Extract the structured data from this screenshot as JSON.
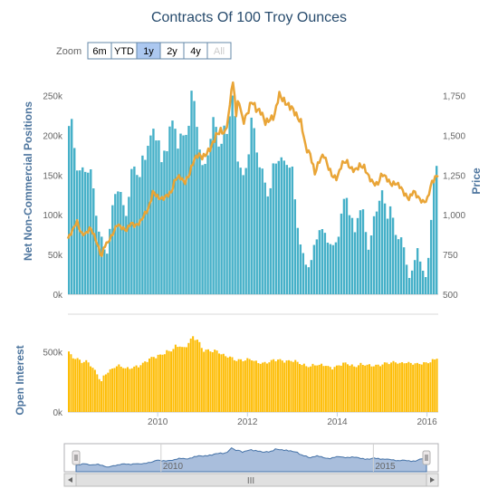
{
  "chart_data": {
    "title": "Contracts Of 100 Troy Ounces",
    "zoom": {
      "label": "Zoom",
      "buttons": [
        {
          "label": "6m",
          "state": "normal"
        },
        {
          "label": "YTD",
          "state": "normal"
        },
        {
          "label": "1y",
          "state": "selected"
        },
        {
          "label": "2y",
          "state": "normal"
        },
        {
          "label": "4y",
          "state": "normal"
        },
        {
          "label": "All",
          "state": "disabled"
        }
      ]
    },
    "colors": {
      "positions": "#45b0c8",
      "price": "#e9a537",
      "open_interest": "#fdbd06",
      "navigator_fill": "#a9bedc",
      "navigator_line": "#4572a7",
      "axis_title": "#4d759e",
      "title": "#274b6d"
    },
    "x_axis": {
      "type": "datetime",
      "range": [
        2008.0,
        2016.25
      ],
      "ticks": [
        "2010",
        "2012",
        "2014",
        "2016"
      ],
      "tick_values": [
        2010,
        2012,
        2014,
        2016
      ]
    },
    "top_panel": {
      "type": "column+line",
      "left_axis": {
        "title": "Net Non-Commercial Positions",
        "range": [
          0,
          270000
        ],
        "ticks": [
          "0k",
          "50k",
          "100k",
          "150k",
          "200k",
          "250k"
        ],
        "tick_values": [
          0,
          50000,
          100000,
          150000,
          200000,
          250000
        ]
      },
      "right_axis": {
        "title": "Price",
        "range": [
          500,
          1850
        ],
        "ticks": [
          "500",
          "750",
          "1,000",
          "1,250",
          "1,500",
          "1,750"
        ],
        "tick_values": [
          500,
          750,
          1000,
          1250,
          1500,
          1750
        ]
      },
      "positions": [
        [
          2008.0,
          205000
        ],
        [
          2008.1,
          200000
        ],
        [
          2008.2,
          165000
        ],
        [
          2008.3,
          150000
        ],
        [
          2008.4,
          170000
        ],
        [
          2008.5,
          160000
        ],
        [
          2008.6,
          120000
        ],
        [
          2008.7,
          75000
        ],
        [
          2008.8,
          60000
        ],
        [
          2008.85,
          45000
        ],
        [
          2008.9,
          60000
        ],
        [
          2009.0,
          110000
        ],
        [
          2009.1,
          150000
        ],
        [
          2009.2,
          120000
        ],
        [
          2009.3,
          100000
        ],
        [
          2009.4,
          135000
        ],
        [
          2009.5,
          160000
        ],
        [
          2009.6,
          145000
        ],
        [
          2009.7,
          175000
        ],
        [
          2009.8,
          205000
        ],
        [
          2009.9,
          200000
        ],
        [
          2010.0,
          210000
        ],
        [
          2010.1,
          150000
        ],
        [
          2010.2,
          185000
        ],
        [
          2010.3,
          210000
        ],
        [
          2010.4,
          215000
        ],
        [
          2010.5,
          200000
        ],
        [
          2010.6,
          200000
        ],
        [
          2010.7,
          220000
        ],
        [
          2010.8,
          240000
        ],
        [
          2010.9,
          205000
        ],
        [
          2011.0,
          150000
        ],
        [
          2011.1,
          185000
        ],
        [
          2011.2,
          205000
        ],
        [
          2011.3,
          230000
        ],
        [
          2011.4,
          170000
        ],
        [
          2011.5,
          200000
        ],
        [
          2011.6,
          215000
        ],
        [
          2011.7,
          245000
        ],
        [
          2011.8,
          180000
        ],
        [
          2011.9,
          145000
        ],
        [
          2012.0,
          175000
        ],
        [
          2012.1,
          210000
        ],
        [
          2012.2,
          185000
        ],
        [
          2012.3,
          150000
        ],
        [
          2012.4,
          140000
        ],
        [
          2012.5,
          130000
        ],
        [
          2012.6,
          170000
        ],
        [
          2012.7,
          180000
        ],
        [
          2012.8,
          155000
        ],
        [
          2012.9,
          165000
        ],
        [
          2013.0,
          150000
        ],
        [
          2013.1,
          100000
        ],
        [
          2013.2,
          60000
        ],
        [
          2013.3,
          40000
        ],
        [
          2013.4,
          35000
        ],
        [
          2013.5,
          60000
        ],
        [
          2013.6,
          80000
        ],
        [
          2013.7,
          75000
        ],
        [
          2013.8,
          70000
        ],
        [
          2013.9,
          60000
        ],
        [
          2014.0,
          70000
        ],
        [
          2014.1,
          100000
        ],
        [
          2014.2,
          125000
        ],
        [
          2014.3,
          95000
        ],
        [
          2014.4,
          75000
        ],
        [
          2014.5,
          115000
        ],
        [
          2014.6,
          100000
        ],
        [
          2014.7,
          60000
        ],
        [
          2014.8,
          85000
        ],
        [
          2014.9,
          110000
        ],
        [
          2015.0,
          125000
        ],
        [
          2015.1,
          95000
        ],
        [
          2015.2,
          115000
        ],
        [
          2015.3,
          75000
        ],
        [
          2015.4,
          80000
        ],
        [
          2015.5,
          55000
        ],
        [
          2015.6,
          20000
        ],
        [
          2015.7,
          30000
        ],
        [
          2015.8,
          60000
        ],
        [
          2015.9,
          30000
        ],
        [
          2016.0,
          20000
        ],
        [
          2016.1,
          100000
        ],
        [
          2016.2,
          160000
        ],
        [
          2016.25,
          170000
        ]
      ],
      "price": [
        [
          2008.0,
          850
        ],
        [
          2008.1,
          900
        ],
        [
          2008.2,
          960
        ],
        [
          2008.3,
          880
        ],
        [
          2008.4,
          880
        ],
        [
          2008.5,
          920
        ],
        [
          2008.6,
          860
        ],
        [
          2008.7,
          780
        ],
        [
          2008.75,
          730
        ],
        [
          2008.8,
          800
        ],
        [
          2008.9,
          830
        ],
        [
          2009.0,
          880
        ],
        [
          2009.1,
          940
        ],
        [
          2009.2,
          920
        ],
        [
          2009.3,
          900
        ],
        [
          2009.4,
          950
        ],
        [
          2009.5,
          930
        ],
        [
          2009.6,
          950
        ],
        [
          2009.7,
          1000
        ],
        [
          2009.8,
          1040
        ],
        [
          2009.9,
          1150
        ],
        [
          2010.0,
          1110
        ],
        [
          2010.1,
          1100
        ],
        [
          2010.2,
          1120
        ],
        [
          2010.3,
          1140
        ],
        [
          2010.4,
          1230
        ],
        [
          2010.5,
          1240
        ],
        [
          2010.6,
          1200
        ],
        [
          2010.7,
          1250
        ],
        [
          2010.8,
          1340
        ],
        [
          2010.9,
          1380
        ],
        [
          2011.0,
          1360
        ],
        [
          2011.1,
          1390
        ],
        [
          2011.2,
          1430
        ],
        [
          2011.3,
          1500
        ],
        [
          2011.4,
          1530
        ],
        [
          2011.5,
          1510
        ],
        [
          2011.6,
          1650
        ],
        [
          2011.65,
          1830
        ],
        [
          2011.7,
          1800
        ],
        [
          2011.75,
          1620
        ],
        [
          2011.8,
          1740
        ],
        [
          2011.9,
          1580
        ],
        [
          2012.0,
          1640
        ],
        [
          2012.1,
          1720
        ],
        [
          2012.2,
          1660
        ],
        [
          2012.3,
          1650
        ],
        [
          2012.4,
          1580
        ],
        [
          2012.5,
          1600
        ],
        [
          2012.6,
          1620
        ],
        [
          2012.7,
          1760
        ],
        [
          2012.8,
          1720
        ],
        [
          2012.9,
          1690
        ],
        [
          2013.0,
          1670
        ],
        [
          2013.1,
          1620
        ],
        [
          2013.2,
          1580
        ],
        [
          2013.3,
          1420
        ],
        [
          2013.4,
          1380
        ],
        [
          2013.5,
          1260
        ],
        [
          2013.6,
          1340
        ],
        [
          2013.7,
          1380
        ],
        [
          2013.8,
          1300
        ],
        [
          2013.9,
          1240
        ],
        [
          2014.0,
          1230
        ],
        [
          2014.1,
          1320
        ],
        [
          2014.2,
          1340
        ],
        [
          2014.3,
          1290
        ],
        [
          2014.4,
          1280
        ],
        [
          2014.5,
          1310
        ],
        [
          2014.6,
          1300
        ],
        [
          2014.7,
          1240
        ],
        [
          2014.8,
          1200
        ],
        [
          2014.9,
          1190
        ],
        [
          2015.0,
          1260
        ],
        [
          2015.1,
          1230
        ],
        [
          2015.2,
          1190
        ],
        [
          2015.3,
          1200
        ],
        [
          2015.4,
          1180
        ],
        [
          2015.5,
          1130
        ],
        [
          2015.6,
          1100
        ],
        [
          2015.7,
          1150
        ],
        [
          2015.8,
          1110
        ],
        [
          2015.9,
          1080
        ],
        [
          2016.0,
          1090
        ],
        [
          2016.1,
          1200
        ],
        [
          2016.2,
          1240
        ],
        [
          2016.25,
          1250
        ]
      ]
    },
    "bottom_panel": {
      "type": "column",
      "axis": {
        "title": "Open Interest",
        "range": [
          0,
          600000
        ],
        "ticks": [
          "0k",
          "500k"
        ],
        "tick_values": [
          0,
          500000
        ]
      },
      "open_interest": [
        [
          2008.0,
          510000
        ],
        [
          2008.1,
          440000
        ],
        [
          2008.2,
          450000
        ],
        [
          2008.3,
          420000
        ],
        [
          2008.4,
          430000
        ],
        [
          2008.5,
          390000
        ],
        [
          2008.6,
          340000
        ],
        [
          2008.7,
          280000
        ],
        [
          2008.75,
          250000
        ],
        [
          2008.8,
          300000
        ],
        [
          2008.9,
          340000
        ],
        [
          2009.0,
          360000
        ],
        [
          2009.1,
          380000
        ],
        [
          2009.2,
          370000
        ],
        [
          2009.3,
          360000
        ],
        [
          2009.4,
          370000
        ],
        [
          2009.5,
          380000
        ],
        [
          2009.6,
          380000
        ],
        [
          2009.7,
          400000
        ],
        [
          2009.8,
          430000
        ],
        [
          2009.9,
          460000
        ],
        [
          2010.0,
          470000
        ],
        [
          2010.1,
          480000
        ],
        [
          2010.2,
          490000
        ],
        [
          2010.3,
          500000
        ],
        [
          2010.4,
          540000
        ],
        [
          2010.5,
          560000
        ],
        [
          2010.6,
          530000
        ],
        [
          2010.7,
          580000
        ],
        [
          2010.8,
          610000
        ],
        [
          2010.9,
          590000
        ],
        [
          2011.0,
          520000
        ],
        [
          2011.1,
          520000
        ],
        [
          2011.2,
          510000
        ],
        [
          2011.3,
          500000
        ],
        [
          2011.4,
          480000
        ],
        [
          2011.5,
          460000
        ],
        [
          2011.6,
          470000
        ],
        [
          2011.7,
          440000
        ],
        [
          2011.8,
          430000
        ],
        [
          2011.9,
          420000
        ],
        [
          2012.0,
          430000
        ],
        [
          2012.1,
          440000
        ],
        [
          2012.2,
          420000
        ],
        [
          2012.3,
          410000
        ],
        [
          2012.4,
          400000
        ],
        [
          2012.5,
          410000
        ],
        [
          2012.6,
          430000
        ],
        [
          2012.7,
          440000
        ],
        [
          2012.8,
          430000
        ],
        [
          2012.9,
          420000
        ],
        [
          2013.0,
          420000
        ],
        [
          2013.1,
          410000
        ],
        [
          2013.2,
          400000
        ],
        [
          2013.3,
          390000
        ],
        [
          2013.4,
          380000
        ],
        [
          2013.5,
          390000
        ],
        [
          2013.6,
          380000
        ],
        [
          2013.7,
          390000
        ],
        [
          2013.8,
          380000
        ],
        [
          2013.9,
          370000
        ],
        [
          2014.0,
          380000
        ],
        [
          2014.1,
          390000
        ],
        [
          2014.2,
          400000
        ],
        [
          2014.3,
          390000
        ],
        [
          2014.4,
          380000
        ],
        [
          2014.5,
          400000
        ],
        [
          2014.6,
          390000
        ],
        [
          2014.7,
          380000
        ],
        [
          2014.8,
          380000
        ],
        [
          2014.9,
          390000
        ],
        [
          2015.0,
          400000
        ],
        [
          2015.1,
          410000
        ],
        [
          2015.2,
          400000
        ],
        [
          2015.3,
          410000
        ],
        [
          2015.4,
          400000
        ],
        [
          2015.5,
          420000
        ],
        [
          2015.6,
          410000
        ],
        [
          2015.7,
          400000
        ],
        [
          2015.8,
          390000
        ],
        [
          2015.9,
          400000
        ],
        [
          2016.0,
          410000
        ],
        [
          2016.1,
          430000
        ],
        [
          2016.2,
          440000
        ],
        [
          2016.25,
          460000
        ]
      ]
    },
    "navigator": {
      "ticks": [
        "2010",
        "2015"
      ],
      "tick_values": [
        2010,
        2015
      ],
      "scrollbar_grip": "III"
    }
  }
}
